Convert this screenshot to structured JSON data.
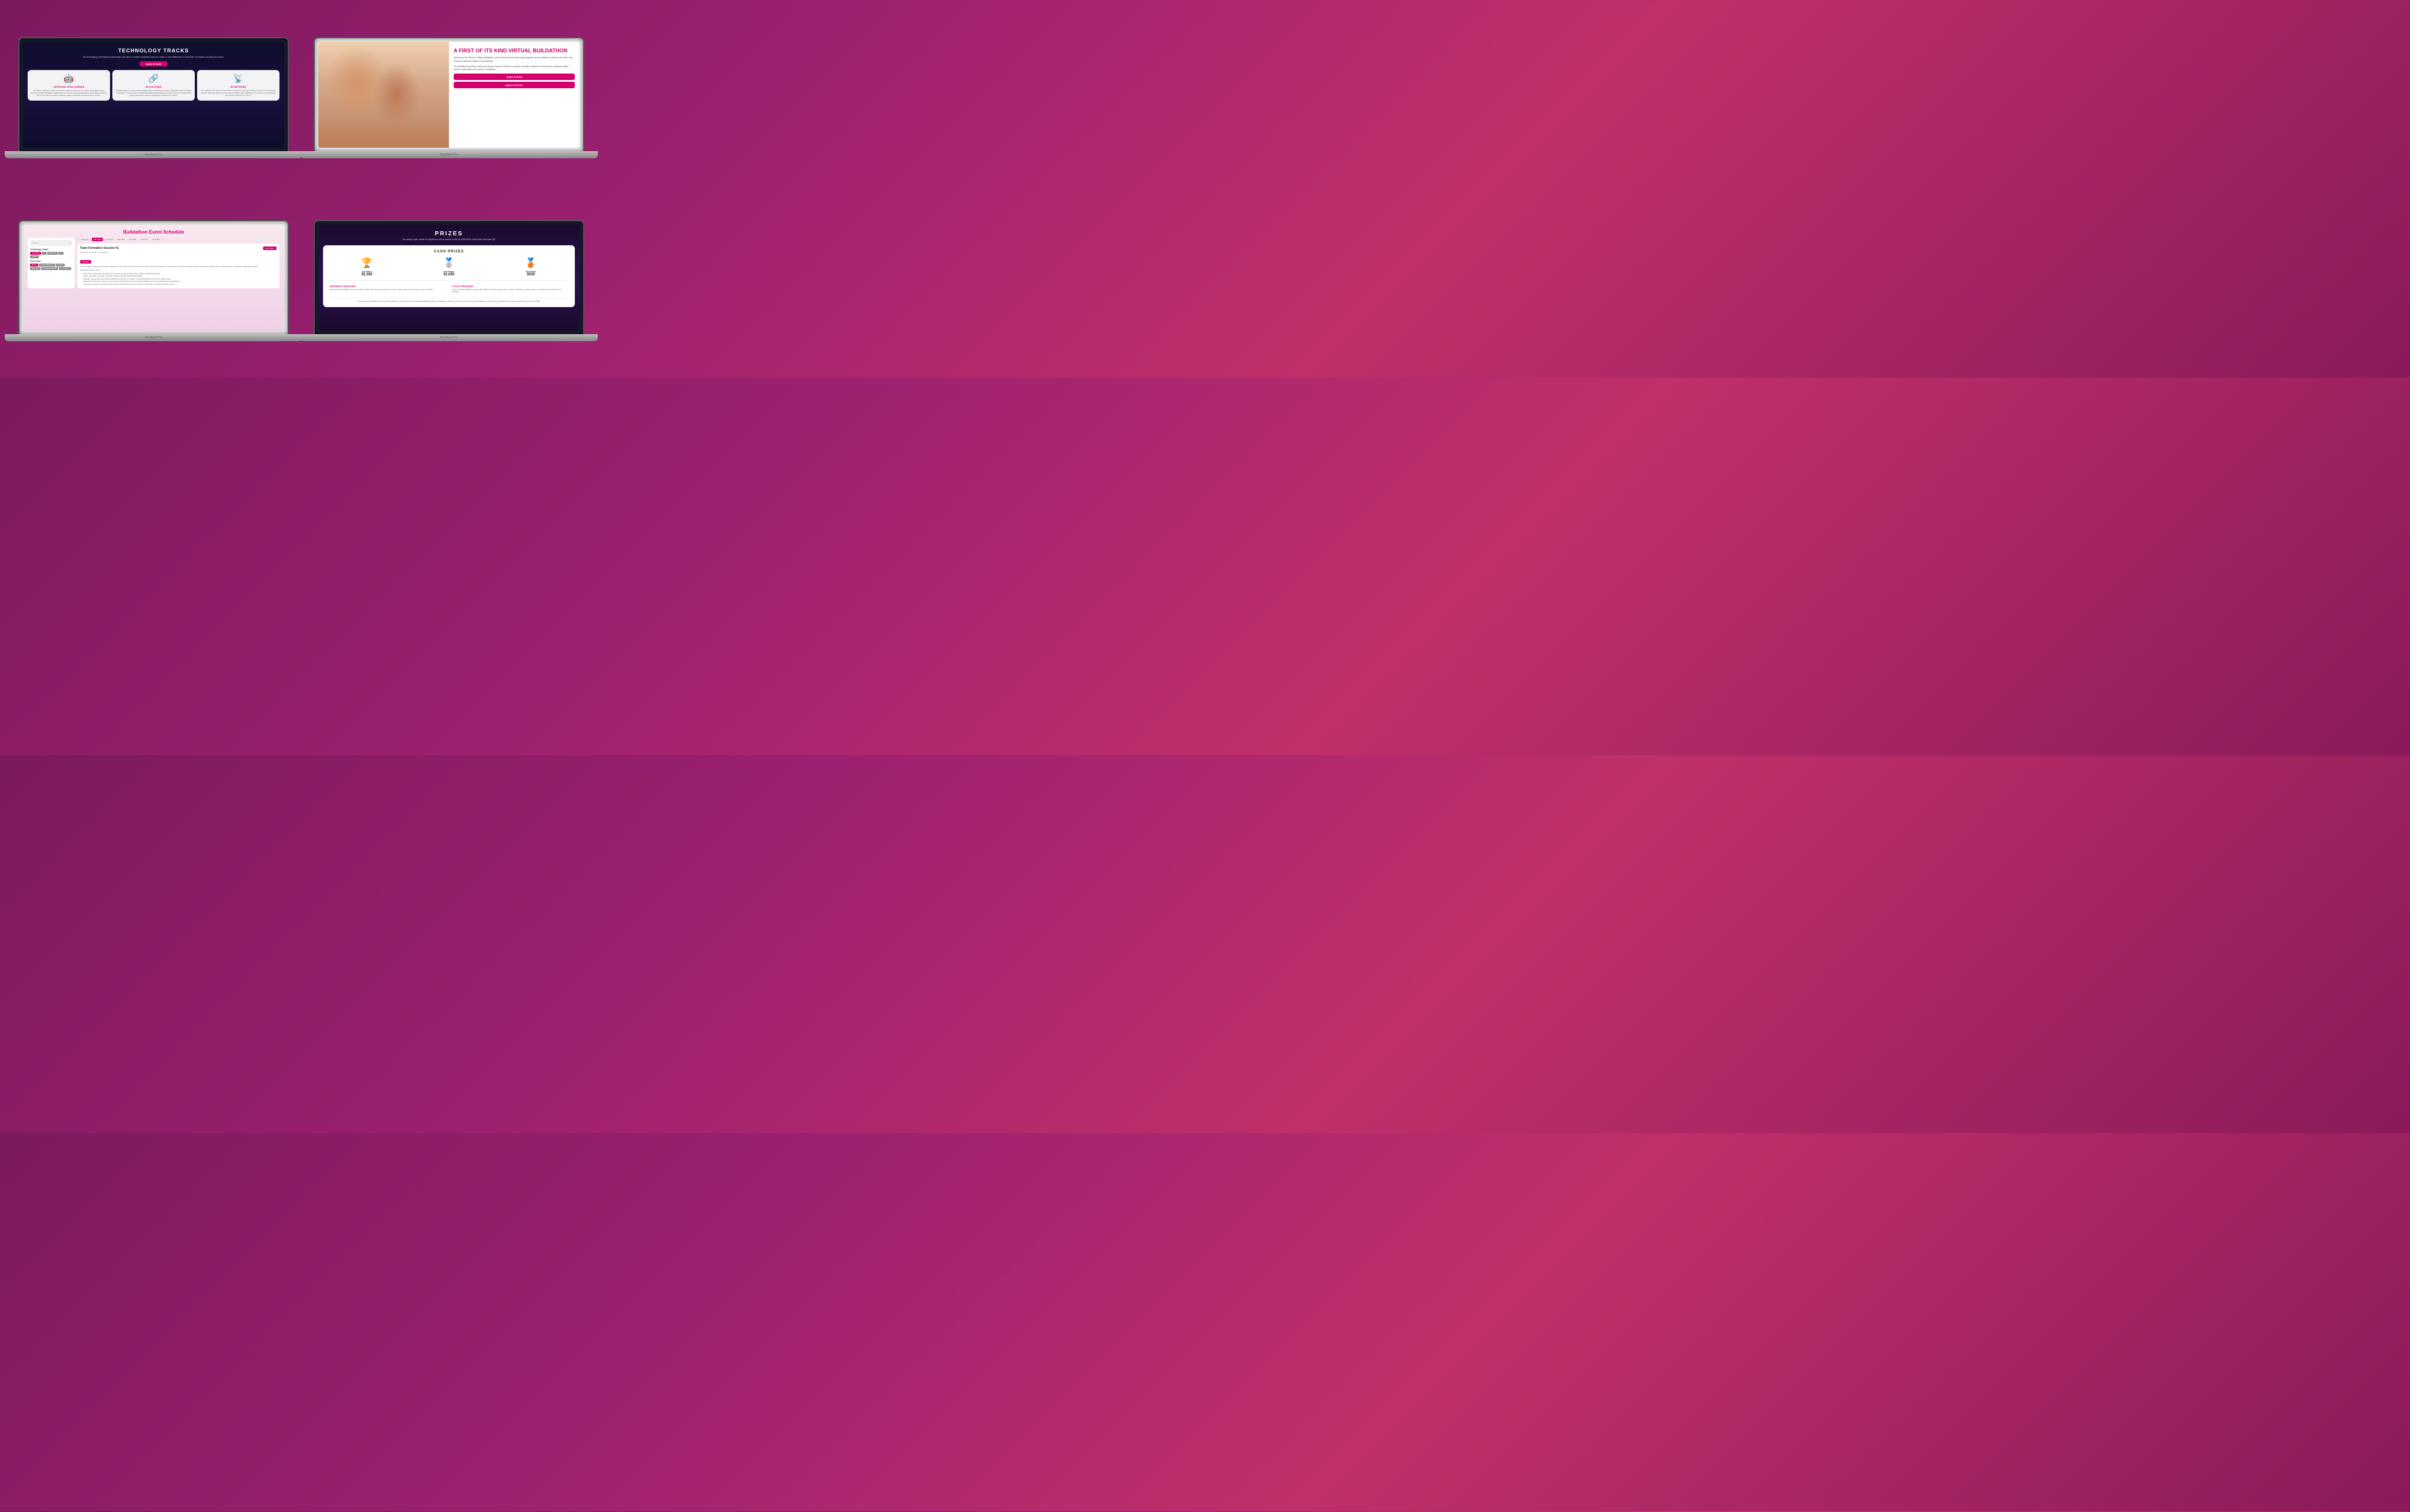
{
  "screens": {
    "screen1": {
      "title": "TECHNOLOGY TRACKS",
      "subtitle": "By leveraging emerging technologies we aim to create solutions that can make a real difference\nin the lives of women around the world.",
      "btn_label": "Apply to Build",
      "cards": [
        {
          "icon": "🤖",
          "title": "ARTIFICIAL INTELLIGENCE",
          "text": "AI enables machines to learn and perform tasks to make our lives easier. By analyzing large amounts of data (healthcare, supply chain, etc.) AI can help identify patterns and make predictions that can be used to improve decision-making processes and outcomes for women."
        },
        {
          "icon": "🔗",
          "title": "BLOCKCHAIN",
          "text": "The Blockchain is a decentralized digital ledger that allows for secure, transparent and immutable transactions. The removal of traditionally biased intermediaries promote financial inclusion, data privacy, and secure identity management solutions for women."
        },
        {
          "icon": "📡",
          "title": "5G NETWORK",
          "text": "5G enables a new kind of network that is designed to connect virtually everyone and everything together. Ultra-low latency and increased reliability offer capabilities for improved communication and security solutions for women."
        }
      ]
    },
    "screen2": {
      "title": "A FIRST OF ITS KIND VIRTUAL BUILDATHON",
      "text1": "Welcome to the Women's Rights Buildathon, a first-of-its-kind event that brings together diverse builders to tackle some of the most pressing challenges facing women globally.",
      "text2": "Our Buildathon provides a safe and inclusive space for women to explore innovative solutions to issues such as gender-based violence, pay equity, and access to healthcare.",
      "btn1": "Apply to Build",
      "btn2": "Apply to Mentor"
    },
    "screen3": {
      "title": "Buildathon Event Schedule",
      "search_placeholder": "Search",
      "sidebar": {
        "filter1_title": "Technology Tracks",
        "tags1": [
          "Community",
          "AI",
          "Blockchain",
          "5G",
          "FinTech"
        ],
        "filter2_title": "Event Type",
        "tags2": [
          "Mentor",
          "Technical Workshop",
          "Network",
          "Discussion",
          "Soft Skills Workshop",
          "Tech Finance"
        ]
      },
      "dates": [
        "All Events",
        "Feb 22nd",
        "Feb 23rd",
        "Feb 24th",
        "Feb 25th",
        "Feb 27th",
        "Feb 28th"
      ],
      "active_date": "Feb 22nd",
      "event": {
        "title": "Team Formation Session #1",
        "date": "Feb 22nd | 12:30 PM - 1:30 PM EST",
        "badge": "Network",
        "btn": "Learn More",
        "desc": "Are you ready to team up and make a difference? Join us for a Team Formation Session, where you'll have the opportunity to connect with fellow builders, brainstorm project ideas, and form teams to tackle the challenges ahead!",
        "desc2": "During this session, you'll:",
        "bullets": [
          "Meet other participants who share your passion for advancing women's rights through technology.",
          "Share your skills, interests, and project ideas to attract potential teammates.",
          "Engage in group discussions and collaborative activities to explore innovative solutions to women's rights issues.",
          "Network with mentors, sponsors, and community partners who can provide guidance and support throughout the buildathon.",
          "Form teams based on complementary skills, shared interests, and a shared commitment to making a positive impact."
        ]
      }
    },
    "screen4": {
      "title": "PRIZES",
      "subtitle": "Get ready to gain hands-on experience with a chance to win up to $5,000 in cash prizes and more! 🎉",
      "cash_title": "CASH PRIZES",
      "prizes": [
        {
          "icon": "🥇",
          "place": "1st Place",
          "amount": "$1,500"
        },
        {
          "icon": "🥈",
          "place": "2nd Place",
          "amount": "$1,000"
        },
        {
          "icon": "🥉",
          "place": "3rd Place",
          "amount": "$500"
        }
      ],
      "special": [
        {
          "title": "SAFENEST PRIZE $500",
          "text": "Safenest will award $500 to a project that leverages technology to empower survivors, prevent violence, and support recovery efforts."
        },
        {
          "title": "CYTEC PRIZE $500",
          "text": "Cytec is awarding $500 to a project that utilizes innovative approaches to prevent trafficking, support survivors, and disrupt the operations of traffickers."
        }
      ],
      "raffle_text": "Throughout the Buildathon, we'll be hosting raffles for a variety of prizes, including Buildathon tickets, scholarships, gift cards, and more. It's our way of celebrating your hard work and dedication to making a difference in women's rights!"
    }
  }
}
